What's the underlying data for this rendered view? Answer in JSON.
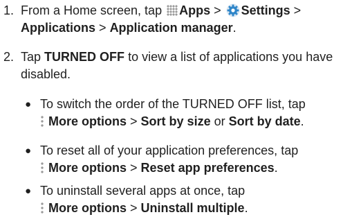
{
  "steps": [
    {
      "number": "1.",
      "pre": "From a Home screen, tap",
      "apps": "Apps",
      "gt1": ">",
      "settings": "Settings",
      "gt2": ">",
      "applications": "Applications",
      "gt3": ">",
      "app_manager": "Application manager",
      "end": "."
    },
    {
      "number": "2.",
      "pre": "Tap",
      "turned_off": "TURNED OFF",
      "post": "to view a list of applications you have disabled."
    }
  ],
  "bullets": [
    {
      "pre": "To switch the order of the TURNED OFF list, tap",
      "more": "More options",
      "gt": ">",
      "opt1": "Sort by size",
      "or": "or",
      "opt2": "Sort by date",
      "end": "."
    },
    {
      "pre": "To reset all of your application preferences, tap",
      "more": "More options",
      "gt": ">",
      "opt1": "Reset app preferences",
      "end": "."
    },
    {
      "pre": "To uninstall several apps at once, tap",
      "more": "More options",
      "gt": ">",
      "opt1": "Uninstall multiple",
      "end": "."
    }
  ],
  "bullet_glyph": "●",
  "icons": {
    "apps": "apps-grid-icon",
    "settings": "settings-gear-icon",
    "more": "more-options-icon"
  },
  "colors": {
    "text": "#1f1f1f",
    "icon_gray": "#9a9a9a",
    "gear_blue": "#2f86c9"
  }
}
